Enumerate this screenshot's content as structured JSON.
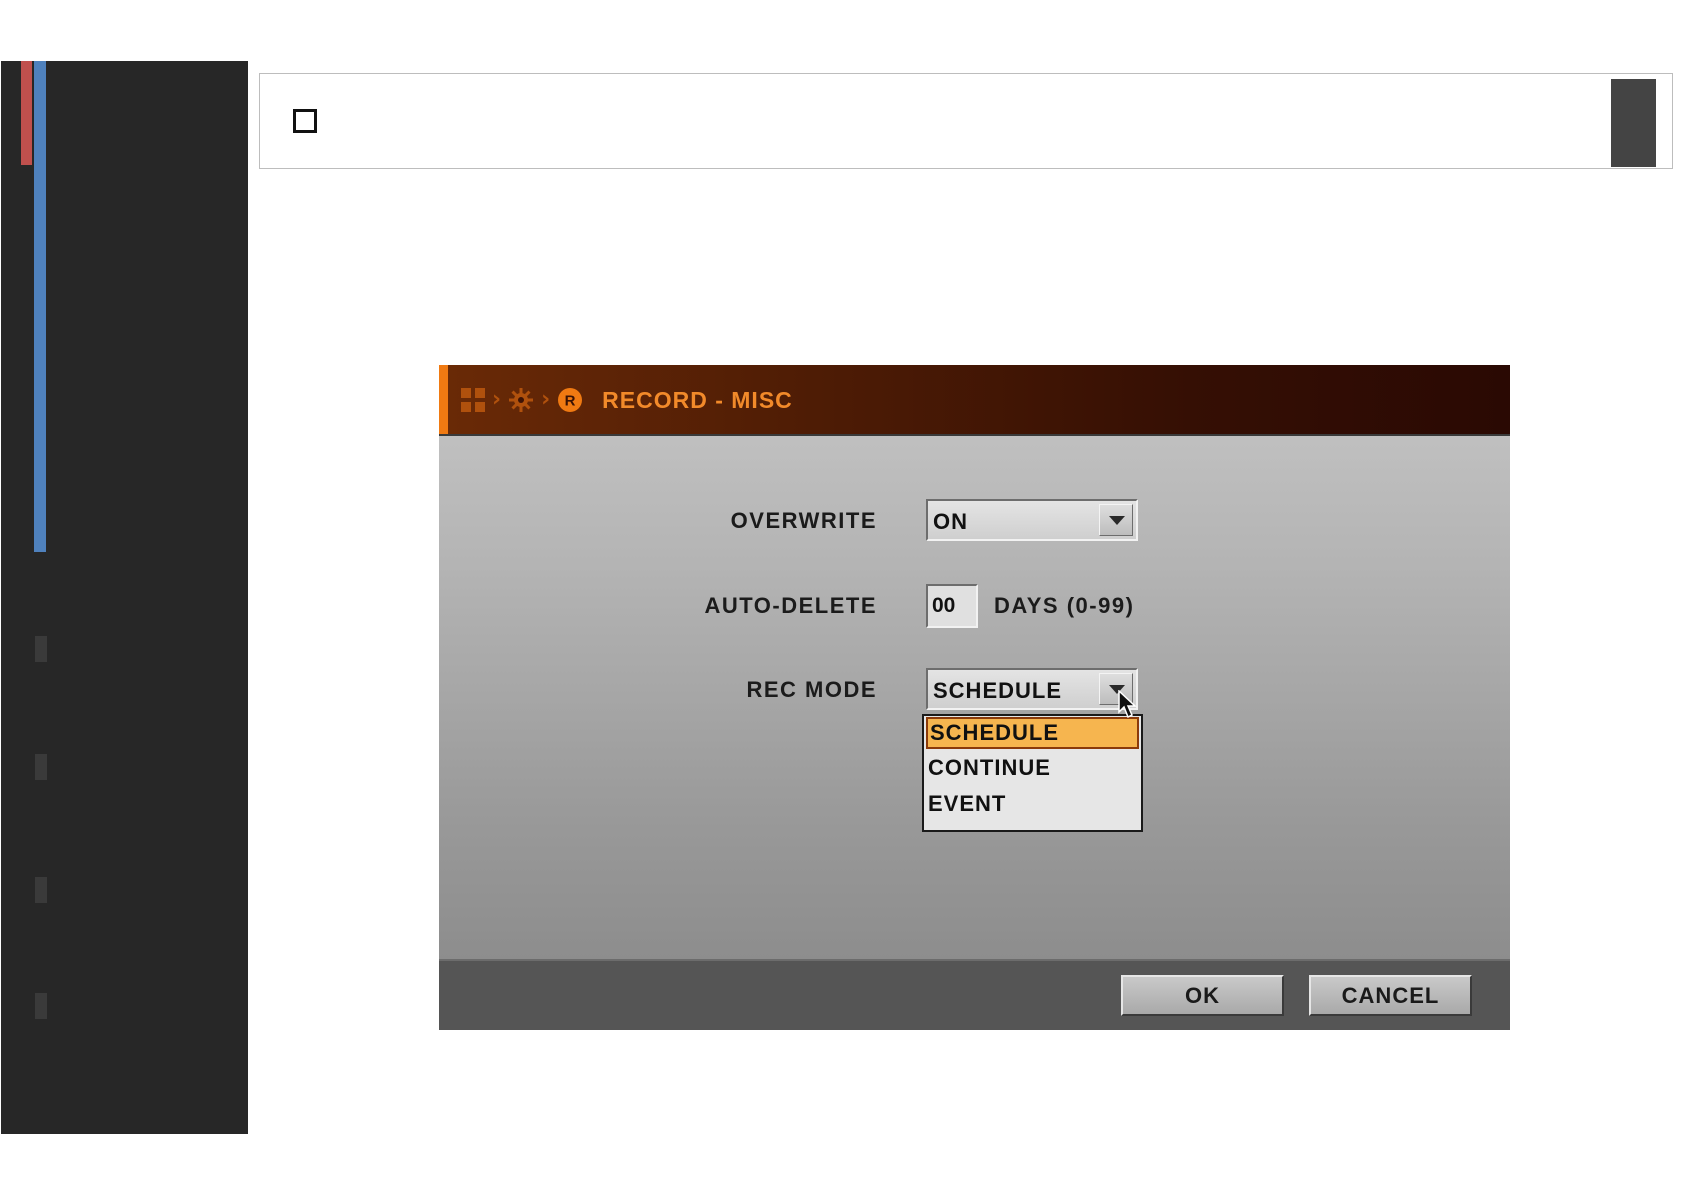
{
  "window": {
    "title": "RECORD - MISC",
    "breadcrumb_icons": [
      "grid-icon",
      "gear-icon",
      "record-icon"
    ]
  },
  "form": {
    "overwrite": {
      "label": "OVERWRITE",
      "value": "ON"
    },
    "auto_delete": {
      "label": "AUTO-DELETE",
      "value": "00",
      "hint": "DAYS (0-99)"
    },
    "rec_mode": {
      "label": "REC MODE",
      "value": "SCHEDULE",
      "options": [
        "SCHEDULE",
        "CONTINUE",
        "EVENT"
      ],
      "highlighted": "SCHEDULE"
    }
  },
  "buttons": {
    "ok": "OK",
    "cancel": "CANCEL"
  },
  "colors": {
    "accent": "#f07a12",
    "title_text": "#f28a2a",
    "highlight": "#f6b54f",
    "sidebar_red": "#c0504d",
    "sidebar_blue": "#4f81bd"
  }
}
